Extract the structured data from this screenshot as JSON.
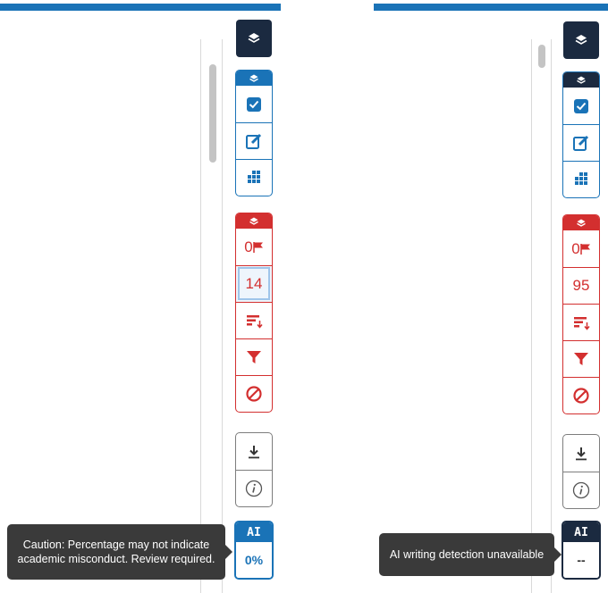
{
  "colors": {
    "blue": "#1a73b7",
    "red": "#d32f2f",
    "dark": "#1b2a40",
    "gray": "#7d7d7d",
    "tooltip": "#3a3a3a"
  },
  "left": {
    "similarity_count": "0",
    "match_count": "14",
    "ai_label": "AI",
    "ai_value": "0%",
    "tooltip": "Caution: Percentage may not indicate academic misconduct. Review required."
  },
  "right": {
    "similarity_count": "0",
    "match_count": "95",
    "ai_label": "AI",
    "ai_value": "--",
    "tooltip": "AI writing detection unavailable"
  },
  "icons": [
    "layers-icon",
    "checkbox-icon",
    "edit-icon",
    "grid-icon",
    "flag-icon",
    "sort-icon",
    "filter-icon",
    "exclude-icon",
    "download-icon",
    "info-icon"
  ]
}
